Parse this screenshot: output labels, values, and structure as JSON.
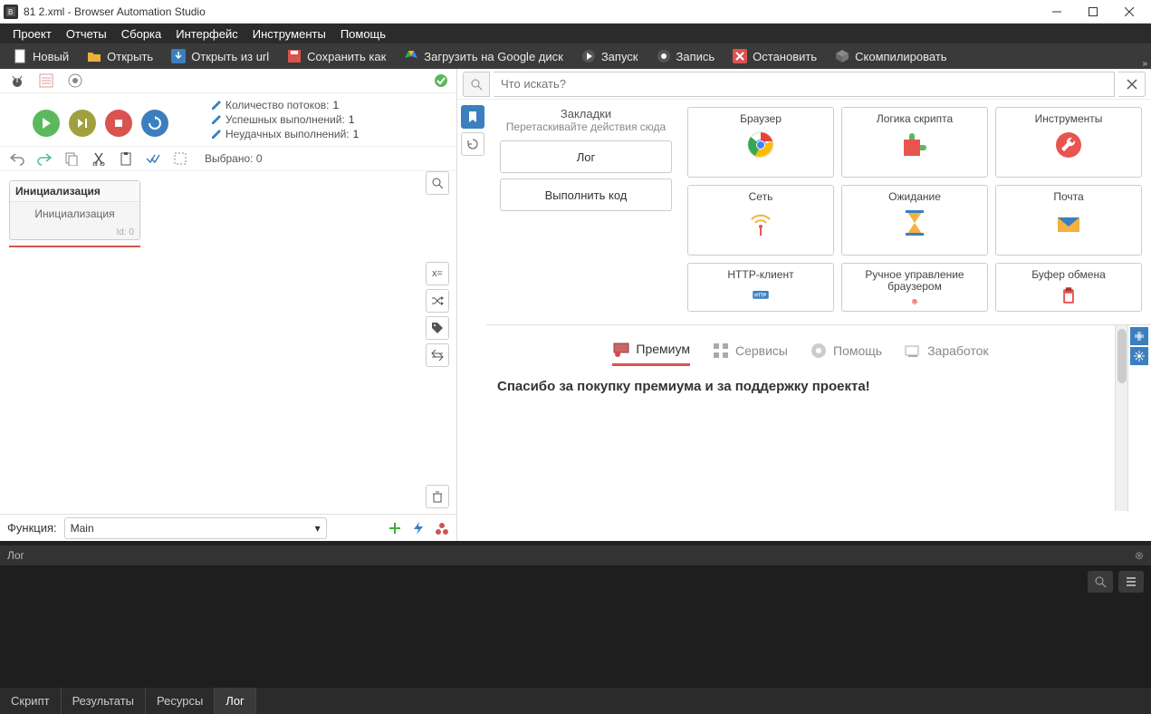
{
  "titlebar": {
    "title": "81 2.xml - Browser Automation Studio"
  },
  "menu": [
    "Проект",
    "Отчеты",
    "Сборка",
    "Интерфейс",
    "Инструменты",
    "Помощь"
  ],
  "toolbar": {
    "new": "Новый",
    "open": "Открыть",
    "open_url": "Открыть из url",
    "save_as": "Сохранить как",
    "google_drive": "Загрузить на Google диск",
    "run": "Запуск",
    "record": "Запись",
    "stop": "Остановить",
    "compile": "Скомпилировать"
  },
  "stats": {
    "threads_label": "Количество потоков:",
    "threads": "1",
    "success_label": "Успешных выполнений:",
    "success": "1",
    "fail_label": "Неудачных выполнений:",
    "fail": "1"
  },
  "selected": {
    "label": "Выбрано:",
    "count": "0"
  },
  "block": {
    "title": "Инициализация",
    "body": "Инициализация",
    "id_label": "Id: 0"
  },
  "func": {
    "label": "Функция:",
    "value": "Main"
  },
  "search": {
    "placeholder": "Что искать?"
  },
  "bookmarks": {
    "title": "Закладки",
    "hint": "Перетаскивайте действия сюда",
    "log_btn": "Лог",
    "exec_btn": "Выполнить код"
  },
  "modules": {
    "browser": "Браузер",
    "script_logic": "Логика скрипта",
    "tools": "Инструменты",
    "network": "Сеть",
    "wait": "Ожидание",
    "mail": "Почта",
    "http_client": "HTTP-клиент",
    "manual_browser": "Ручное управление браузером",
    "clipboard": "Буфер обмена"
  },
  "premium": {
    "tab_premium": "Премиум",
    "tab_services": "Сервисы",
    "tab_help": "Помощь",
    "tab_earn": "Заработок",
    "thanks": "Спасибо за покупку премиума и за поддержку проекта!"
  },
  "right_tool_labels": {
    "xequals": "x="
  },
  "log": {
    "title": "Лог"
  },
  "bottom_tabs": {
    "script": "Скрипт",
    "results": "Результаты",
    "resources": "Ресурсы",
    "log": "Лог"
  }
}
